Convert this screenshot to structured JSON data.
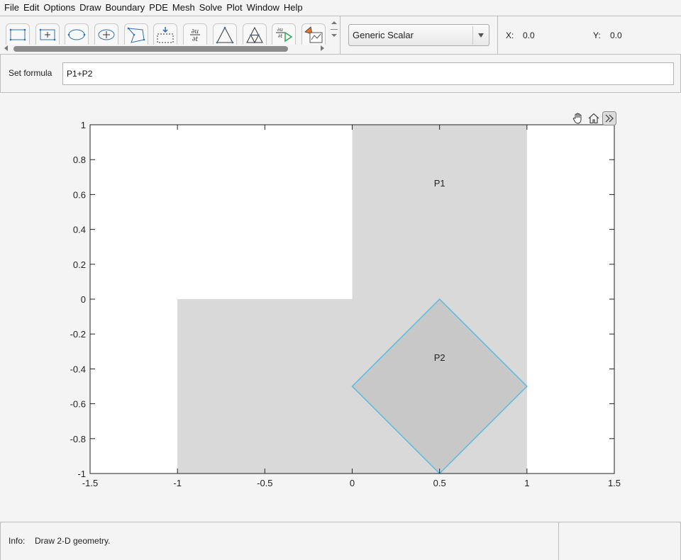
{
  "menu": [
    "File",
    "Edit",
    "Options",
    "Draw",
    "Boundary",
    "PDE",
    "Mesh",
    "Solve",
    "Plot",
    "Window",
    "Help"
  ],
  "toolbar": {
    "tools": [
      {
        "name": "rectangle-corner-tool-icon"
      },
      {
        "name": "rectangle-center-tool-icon"
      },
      {
        "name": "ellipse-corner-tool-icon"
      },
      {
        "name": "ellipse-center-tool-icon"
      },
      {
        "name": "polygon-tool-icon"
      },
      {
        "name": "boundary-mode-icon"
      },
      {
        "name": "pde-spec-icon"
      },
      {
        "name": "init-mesh-icon"
      },
      {
        "name": "refine-mesh-icon"
      },
      {
        "name": "solve-pde-icon"
      },
      {
        "name": "plot-solution-icon"
      }
    ]
  },
  "mode": {
    "selected": "Generic Scalar"
  },
  "coords": {
    "x_label": "X:",
    "x_value": "0.0",
    "y_label": "Y:",
    "y_value": "0.0"
  },
  "formula": {
    "label": "Set formula",
    "value": "P1+P2"
  },
  "status": {
    "label": "Info:",
    "message": "Draw 2-D geometry."
  },
  "colors": {
    "region_fill": "#d9d9d9",
    "selected_fill": "#c8c8c8",
    "selected_edge": "#5bbbe0",
    "axes": "#222222"
  },
  "chart_data": {
    "type": "geometry",
    "xlim": [
      -1.5,
      1.5
    ],
    "ylim": [
      -1,
      1
    ],
    "xticks": [
      "-1.5",
      "-1",
      "-0.5",
      "0",
      "0.5",
      "1",
      "1.5"
    ],
    "xtick_values": [
      -1.5,
      -1,
      -0.5,
      0,
      0.5,
      1,
      1.5
    ],
    "yticks": [
      "1",
      "0.8",
      "0.6",
      "0.4",
      "0.2",
      "0",
      "-0.2",
      "-0.4",
      "-0.6",
      "-0.8",
      "-1"
    ],
    "ytick_values": [
      1,
      0.8,
      0.6,
      0.4,
      0.2,
      0,
      -0.2,
      -0.4,
      -0.6,
      -0.8,
      -1
    ],
    "shapes": [
      {
        "label": "P1",
        "kind": "polygon",
        "points": [
          [
            0,
            1
          ],
          [
            1,
            1
          ],
          [
            1,
            -1
          ],
          [
            -1,
            -1
          ],
          [
            -1,
            0
          ],
          [
            0,
            0
          ]
        ],
        "label_at": [
          0.5,
          0.667
        ],
        "selected": false
      },
      {
        "label": "P2",
        "kind": "polygon",
        "points": [
          [
            0.5,
            0
          ],
          [
            1,
            -0.5
          ],
          [
            0.5,
            -1
          ],
          [
            0,
            -0.5
          ]
        ],
        "label_at": [
          0.5,
          -0.333
        ],
        "selected": true
      }
    ]
  }
}
